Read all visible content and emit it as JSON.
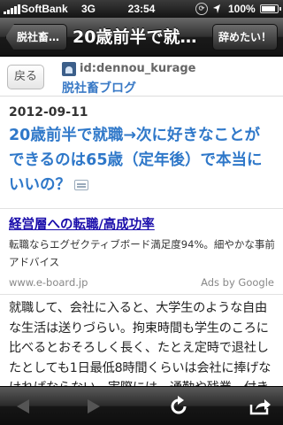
{
  "status_bar": {
    "carrier": "SoftBank",
    "network": "3G",
    "time": "23:54",
    "battery": "100%",
    "icons": [
      "signal-icon",
      "rotation-lock-icon",
      "location-icon",
      "battery-icon"
    ]
  },
  "nav": {
    "back_label": "脱社畜…",
    "title": "20歳前半で就…",
    "right_label": "辞めたい！"
  },
  "blog": {
    "back_button": "戻る",
    "user_id": "id:dennou_kurage",
    "blog_name": "脱社畜ブログ"
  },
  "post": {
    "date": "2012-09-11",
    "title": "20歳前半で就職→次に好きなことができるのは65歳（定年後）で本当にいいの？"
  },
  "ad": {
    "title": "経営層への転職/高成功率",
    "description": "転職ならエグゼクティブボード満足度94%。細やかな事前アドバイス",
    "url": "www.e-board.jp",
    "by": "Ads by Google"
  },
  "body": {
    "text": "就職して、会社に入ると、大学生のような自由な生活は送りづらい。拘束時間も学生のころに比べるとおそろしく長く、たとえ定時で退社したとしても1日最低8時間くらいは会社に捧げなければならない。実際には、通勤や残業、付き"
  },
  "toolbar": {
    "icons": [
      "back-arrow-icon",
      "forward-arrow-icon",
      "reload-icon",
      "share-icon"
    ]
  },
  "colors": {
    "link": "#2f78c9",
    "ad_link": "#1a0dab",
    "bar_dark": "#161616"
  }
}
